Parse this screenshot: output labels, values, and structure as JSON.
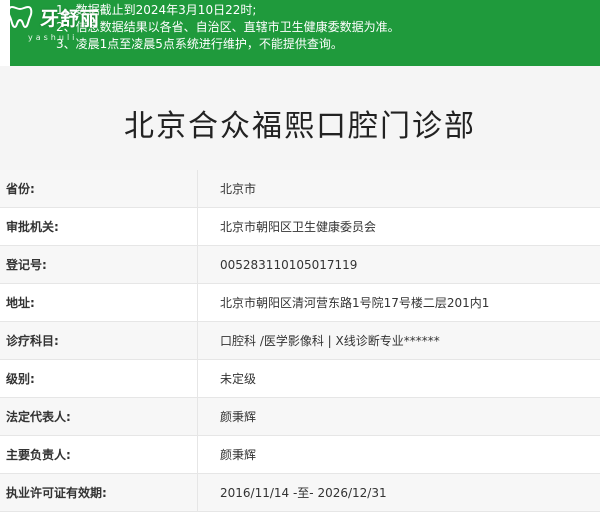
{
  "notice": {
    "lines": [
      "1、数据截止到2024年3月10日22时;",
      "2、信息数据结果以各省、自治区、直辖市卫生健康委数据为准。",
      "3、凌晨1点至凌晨5点系统进行维护，不能提供查询。"
    ]
  },
  "logo": {
    "brand": "牙舒丽",
    "sub": "yashuli",
    "icon": "tooth-icon"
  },
  "page": {
    "title": "北京合众福熙口腔门诊部"
  },
  "details": [
    {
      "label": "省份:",
      "value": "北京市"
    },
    {
      "label": "审批机关:",
      "value": "北京市朝阳区卫生健康委员会"
    },
    {
      "label": "登记号:",
      "value": "005283110105017119"
    },
    {
      "label": "地址:",
      "value": "北京市朝阳区清河营东路1号院17号楼二层201内1"
    },
    {
      "label": "诊疗科目:",
      "value": "口腔科 /医学影像科 | X线诊断专业******"
    },
    {
      "label": "级别:",
      "value": "未定级"
    },
    {
      "label": "法定代表人:",
      "value": "颜秉辉"
    },
    {
      "label": "主要负责人:",
      "value": "颜秉辉"
    },
    {
      "label": "执业许可证有效期:",
      "value": "2016/11/14 -至- 2026/12/31"
    }
  ],
  "colors": {
    "notice_bg": "#1f9a3c",
    "title_bg": "#f5f5f5",
    "row_alt": "#f7f7f7"
  }
}
